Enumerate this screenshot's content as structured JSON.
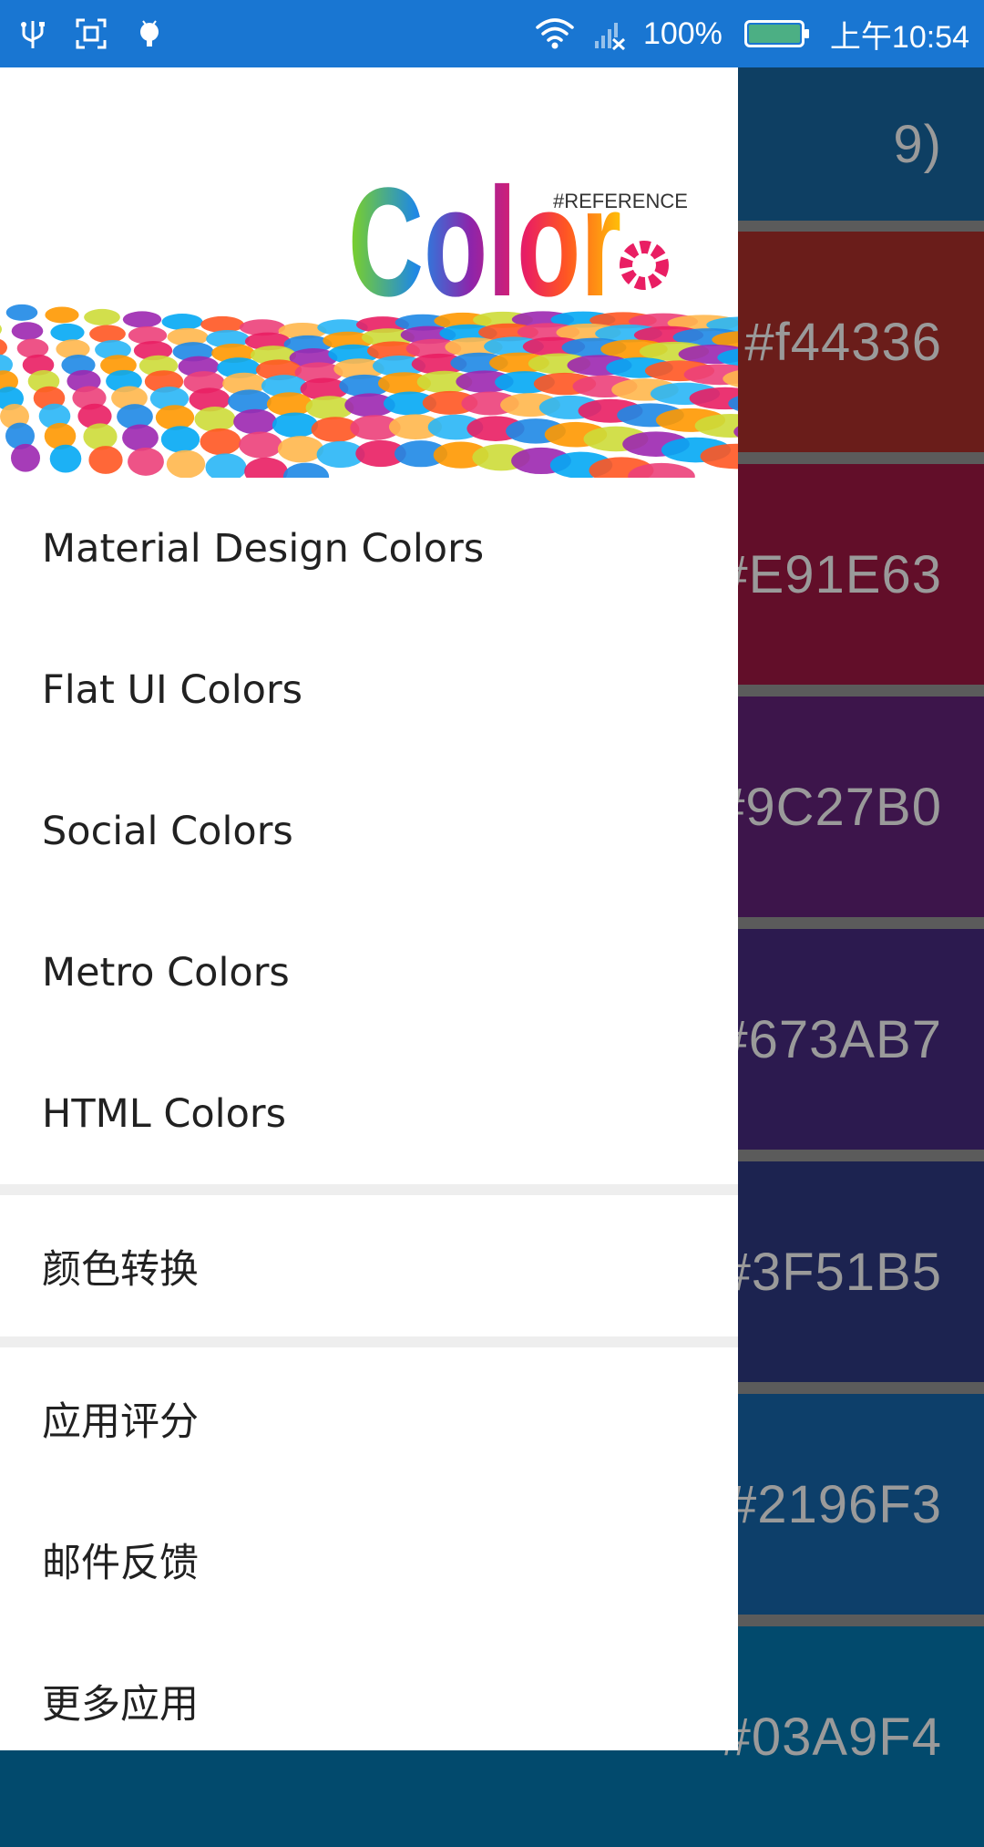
{
  "status_bar": {
    "icons_left": [
      "usb-icon",
      "screenshot-icon",
      "android-debug-icon"
    ],
    "icons_right": [
      "wifi-icon",
      "no-signal-icon",
      "battery-icon"
    ],
    "battery_percent": "100%",
    "battery_level": 1.0,
    "time": "上午10:54"
  },
  "background_list": {
    "partial_top_label": "9)",
    "swatches": [
      {
        "label": "#f44336",
        "color": "#6a1d1a"
      },
      {
        "label": "#E91E63",
        "color": "#620e29"
      },
      {
        "label": "#9C27B0",
        "color": "#3d154b"
      },
      {
        "label": "#673AB7",
        "color": "#2c1a4f"
      },
      {
        "label": "#3F51B5",
        "color": "#1c2350"
      },
      {
        "label": "#2196F3",
        "color": "#0d3f6a"
      },
      {
        "label": "#03A9F4",
        "color": "#024a6d"
      }
    ],
    "top_band_color": "#0e3f63"
  },
  "drawer": {
    "header": {
      "logo_text": "Color",
      "logo_tag": "#REFERENCE"
    },
    "menu_group_1": [
      {
        "label": "Material Design Colors"
      },
      {
        "label": "Flat UI Colors"
      },
      {
        "label": "Social Colors"
      },
      {
        "label": "Metro Colors"
      },
      {
        "label": "HTML Colors"
      }
    ],
    "menu_group_2": [
      {
        "label": "颜色转换"
      }
    ],
    "menu_group_3": [
      {
        "label": "应用评分"
      },
      {
        "label": "邮件反馈"
      },
      {
        "label": "更多应用"
      }
    ]
  }
}
